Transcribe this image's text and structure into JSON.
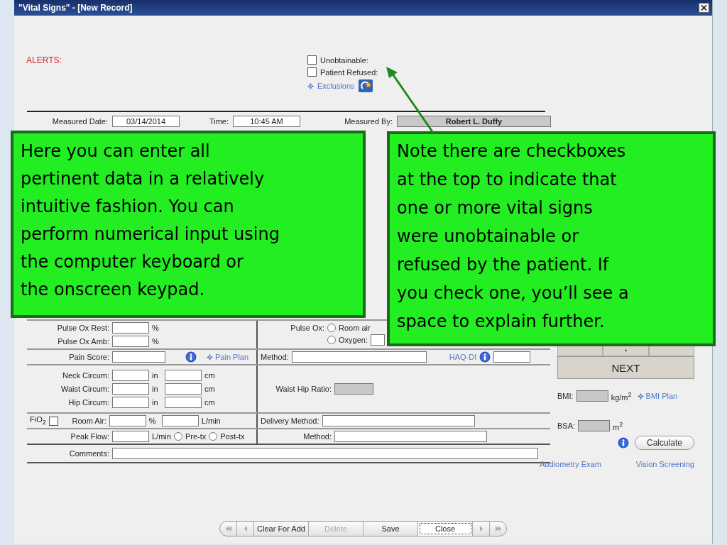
{
  "window": {
    "title": "\"Vital Signs\" - [New Record]"
  },
  "alerts": {
    "label": "ALERTS:"
  },
  "flags": [
    {
      "label": "Unobtainable:",
      "checked": false
    },
    {
      "label": "Patient Refused:",
      "checked": false
    }
  ],
  "exclusions_link": "Exclusions",
  "measured": {
    "date_label": "Measured Date:",
    "date": "03/14/2014",
    "time_label": "Time:",
    "time": "10:45 AM",
    "by_label": "Measured By:",
    "by": "Robert L. Duffy"
  },
  "pulse_ox": {
    "rest_label": "Pulse Ox Rest:",
    "rest_unit": "%",
    "amb_label": "Pulse Ox Amb:",
    "amb_unit": "%",
    "source_label": "Pulse Ox:",
    "options": [
      {
        "label": "Room air",
        "selected": false
      },
      {
        "label": "Oxygen:",
        "selected": false
      }
    ]
  },
  "pain": {
    "label": "Pain Score:",
    "plan_link": "Pain Plan",
    "method_label": "Method:",
    "haq_link": "HAQ-DI"
  },
  "circumferences": [
    {
      "label": "Neck Circum:",
      "unit_1": "in",
      "unit_2": "cm"
    },
    {
      "label": "Waist Circum:",
      "unit_1": "in",
      "unit_2": "cm"
    },
    {
      "label": "Hip Circum:",
      "unit_1": "in",
      "unit_2": "cm"
    }
  ],
  "waist_hip": {
    "label": "Waist Hip Ratio:"
  },
  "fio2": {
    "label": "FiO$_{2}$",
    "checked": false,
    "room_air_label": "Room Air:",
    "unit_1": "%",
    "unit_2": "L/min",
    "delivery_label": "Delivery Method:"
  },
  "peak_flow": {
    "label": "Peak Flow:",
    "unit": "L/min",
    "options": [
      {
        "label": "Pre-tx",
        "selected": false
      },
      {
        "label": "Post-tx",
        "selected": false
      }
    ],
    "method_label": "Method:"
  },
  "comments": {
    "label": "Comments:"
  },
  "keypad": {
    "bottom_key": ".",
    "next": "NEXT"
  },
  "bmi": {
    "label": "BMI:",
    "unit": "kg/m$^{2}$",
    "plan_link": "BMI Plan"
  },
  "bsa": {
    "label": "BSA:",
    "unit": "m$^{2}$"
  },
  "calculate": "Calculate",
  "links": [
    "Audiometry Exam",
    "Vision Screening"
  ],
  "nav": {
    "buttons": [
      {
        "label": "Clear For Add",
        "disabled": false,
        "focused": false
      },
      {
        "label": "Delete",
        "disabled": true,
        "focused": false
      },
      {
        "label": "Save",
        "disabled": false,
        "focused": false
      },
      {
        "label": "Close",
        "disabled": false,
        "focused": true
      }
    ]
  },
  "callouts": [
    {
      "text": "Here you can enter all\npertinent data in a relatively\nintuitive fashion.  You can\nperform numerical input using\nthe computer keyboard or\nthe onscreen keypad."
    },
    {
      "text": "Note there are checkboxes\nat the top to indicate that\none or more vital signs\nwere unobtainable or\nrefused by the patient.  If\nyou check one, you’ll see a\nspace to explain further."
    }
  ]
}
